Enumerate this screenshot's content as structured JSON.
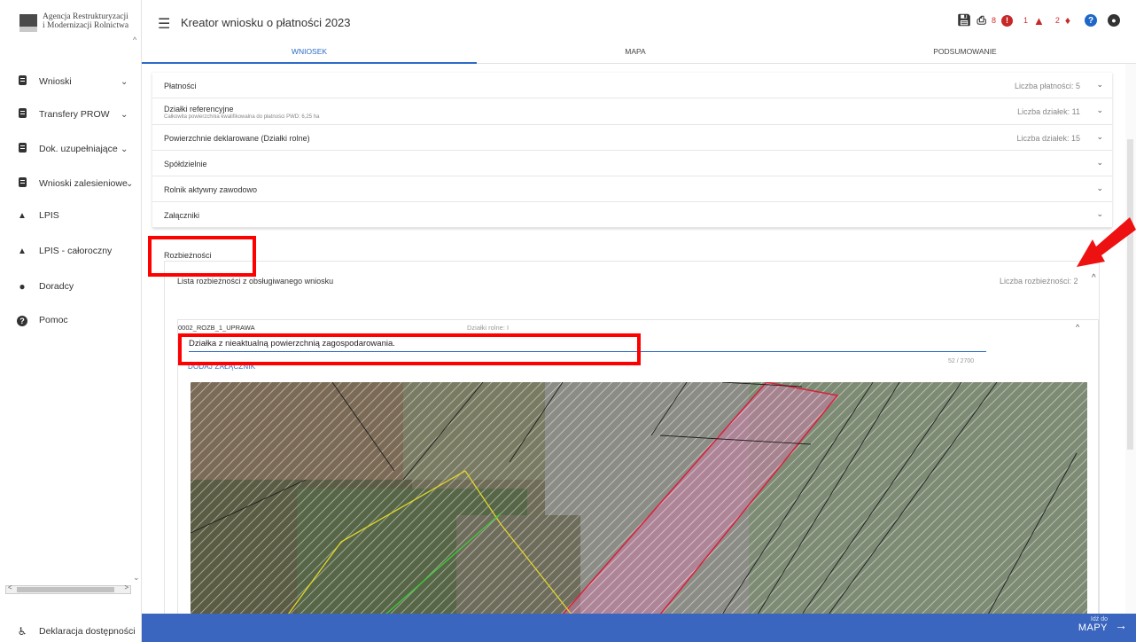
{
  "logo": {
    "line1": "Agencja Restrukturyzacji",
    "line2": "i Modernizacji Rolnictwa"
  },
  "sidebar": {
    "items": [
      {
        "label": "Wnioski",
        "icon": "document-icon",
        "chevron": "⌄"
      },
      {
        "label": "Transfery PROW",
        "icon": "document-icon",
        "chevron": "⌄"
      },
      {
        "label": "Dok. uzupełniające",
        "icon": "document-icon",
        "chevron": "⌄"
      },
      {
        "label": "Wnioski zalesieniowe",
        "icon": "document-icon",
        "chevron": "⌄"
      },
      {
        "label": "LPIS",
        "icon": "mountain-icon"
      },
      {
        "label": "LPIS - całoroczny",
        "icon": "mountain-icon"
      },
      {
        "label": "Doradcy",
        "icon": "person-icon"
      },
      {
        "label": "Pomoc",
        "icon": "help-circle-icon"
      }
    ],
    "accessibility": "Deklaracja dostępności"
  },
  "header": {
    "title": "Kreator wniosku o płatności 2023",
    "counts": {
      "errors": "8",
      "warnings": "1",
      "notifications": "2"
    }
  },
  "tabs": [
    {
      "label": "WNIOSEK",
      "active": true
    },
    {
      "label": "MAPA",
      "active": false
    },
    {
      "label": "PODSUMOWANIE",
      "active": false
    }
  ],
  "panels": [
    {
      "title": "Płatności",
      "right": "Liczba płatności: 5"
    },
    {
      "title": "Działki referencyjne",
      "subtitle": "Całkowita powierzchnia kwalifikowalna do płatności PWD: 6,25 ha",
      "right": "Liczba działek: 11"
    },
    {
      "title": "Powierzchnie deklarowane (Działki rolne)",
      "right": "Liczba działek: 15"
    },
    {
      "title": "Spółdzielnie",
      "right": ""
    },
    {
      "title": "Rolnik aktywny zawodowo",
      "right": ""
    },
    {
      "title": "Załączniki",
      "right": ""
    }
  ],
  "rozbieznosci": {
    "title": "Rozbieżności",
    "list_title": "Lista rozbieżności z obsługiwanego wniosku",
    "list_count": "Liczba rozbieżności: 2",
    "item": {
      "code": "0002_ROZB_1_UPRAWA",
      "category": "Działki rolne: I",
      "description": "Działka z nieaktualną powierzchnią zagospodarowania.",
      "char_count": "52 / 2700",
      "add_attachment": "DODAJ ZAŁĄCZNIK"
    }
  },
  "bottom_bar": {
    "small": "Idź do",
    "big": "MAPY"
  },
  "colors": {
    "accent": "#2e6bc6",
    "bottom_bar": "#3a66bf",
    "highlight": "#ff0000",
    "error": "#c62828"
  }
}
